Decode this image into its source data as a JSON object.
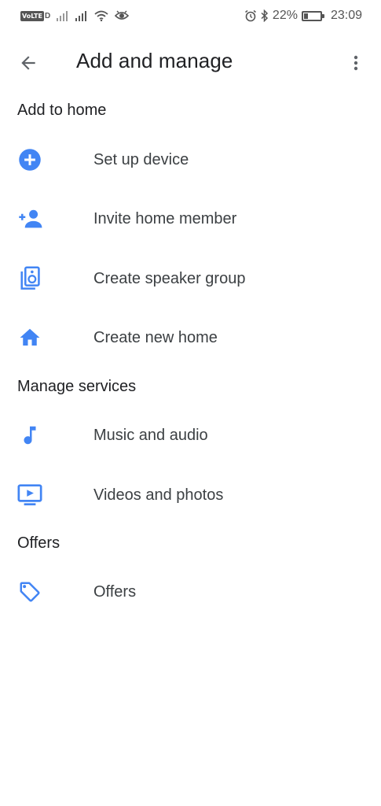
{
  "status_bar": {
    "volte": "VoLTE",
    "volte_d": "D",
    "battery_percent": "22%",
    "battery_level": 0.22,
    "time": "23:09"
  },
  "header": {
    "title": "Add and manage",
    "back_icon": "arrow-back-icon",
    "more_icon": "more-vert-icon"
  },
  "sections": {
    "add_to_home": {
      "title": "Add to home",
      "items": [
        {
          "label": "Set up device",
          "icon": "add-circle-icon"
        },
        {
          "label": "Invite home member",
          "icon": "person-add-icon"
        },
        {
          "label": "Create speaker group",
          "icon": "speaker-icon"
        },
        {
          "label": "Create new home",
          "icon": "home-icon"
        }
      ]
    },
    "manage_services": {
      "title": "Manage services",
      "items": [
        {
          "label": "Music and audio",
          "icon": "music-note-icon"
        },
        {
          "label": "Videos and photos",
          "icon": "video-screen-icon"
        }
      ]
    },
    "offers": {
      "title": "Offers",
      "items": [
        {
          "label": "Offers",
          "icon": "tag-icon"
        }
      ]
    }
  },
  "colors": {
    "accent": "#4285f4",
    "text_primary": "#202124",
    "text_secondary": "#3c4043",
    "status_icons": "#555555"
  }
}
